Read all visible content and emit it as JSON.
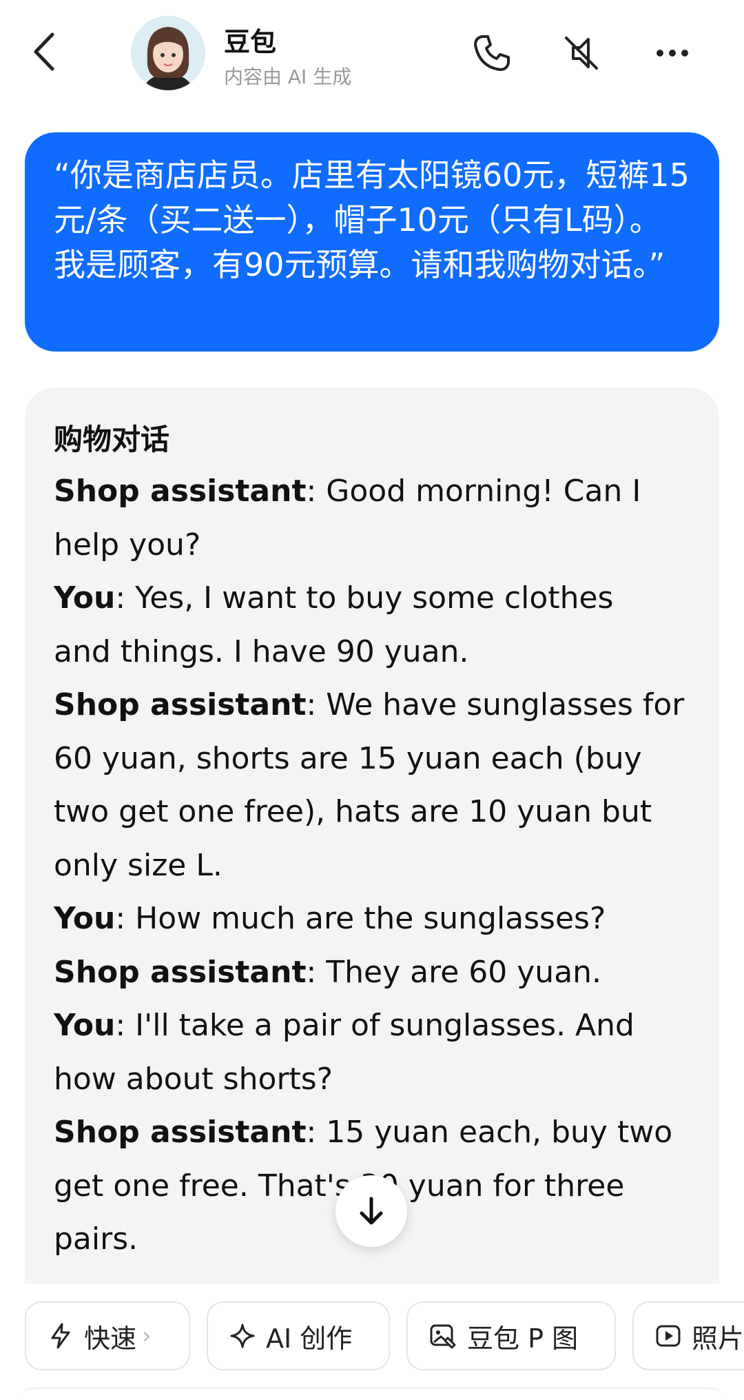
{
  "header": {
    "title": "豆包",
    "subtitle": "内容由 AI 生成",
    "icons": [
      "back-arrow-icon",
      "avatar",
      "phone-icon",
      "speaker-mute-icon",
      "more-icon"
    ]
  },
  "user_message": {
    "text": "“你是商店店员。店里有太阳镜60元，短裤15元/条（买二送一），帽子10元（只有L码）。我是顾客，有90元预算。请和我购物对话。”"
  },
  "ai_message": {
    "heading": "购物对话",
    "lines": [
      {
        "speaker": "Shop assistant",
        "text": ": Good morning! Can I"
      },
      {
        "speaker": "",
        "text": "help you?"
      },
      {
        "speaker": "You",
        "text": ": Yes, I want to buy some clothes"
      },
      {
        "speaker": "",
        "text": "and things. I have 90 yuan."
      },
      {
        "speaker": "Shop assistant",
        "text": ": We have sunglasses for"
      },
      {
        "speaker": "",
        "text": "60 yuan, shorts are 15 yuan each (buy"
      },
      {
        "speaker": "",
        "text": "two get one free), hats are 10 yuan but"
      },
      {
        "speaker": "",
        "text": "only size L."
      },
      {
        "speaker": "You",
        "text": ": How much are the sunglasses?"
      },
      {
        "speaker": "Shop assistant",
        "text": ": They are 60 yuan."
      },
      {
        "speaker": "You",
        "text": ": I'll take a pair of sunglasses. And"
      },
      {
        "speaker": "",
        "text": "how about shorts?"
      },
      {
        "speaker": "Shop assistant",
        "text": ": 15 yuan each, buy two"
      },
      {
        "speaker": "",
        "text": "get one free. That's 30 yuan for three"
      },
      {
        "speaker": "",
        "text": "pairs."
      }
    ]
  },
  "chips": [
    {
      "label": "快速",
      "icon": "lightning-icon",
      "has_chevron": true
    },
    {
      "label": "AI 创作",
      "icon": "sparkle-icon"
    },
    {
      "label": "豆包 P 图",
      "icon": "image-edit-icon"
    },
    {
      "label": "照片",
      "icon": "play-icon"
    }
  ],
  "colors": {
    "accent": "#0f6cff",
    "ai_bubble_bg": "#f4f4f6",
    "subtitle": "#9a9a9a"
  }
}
